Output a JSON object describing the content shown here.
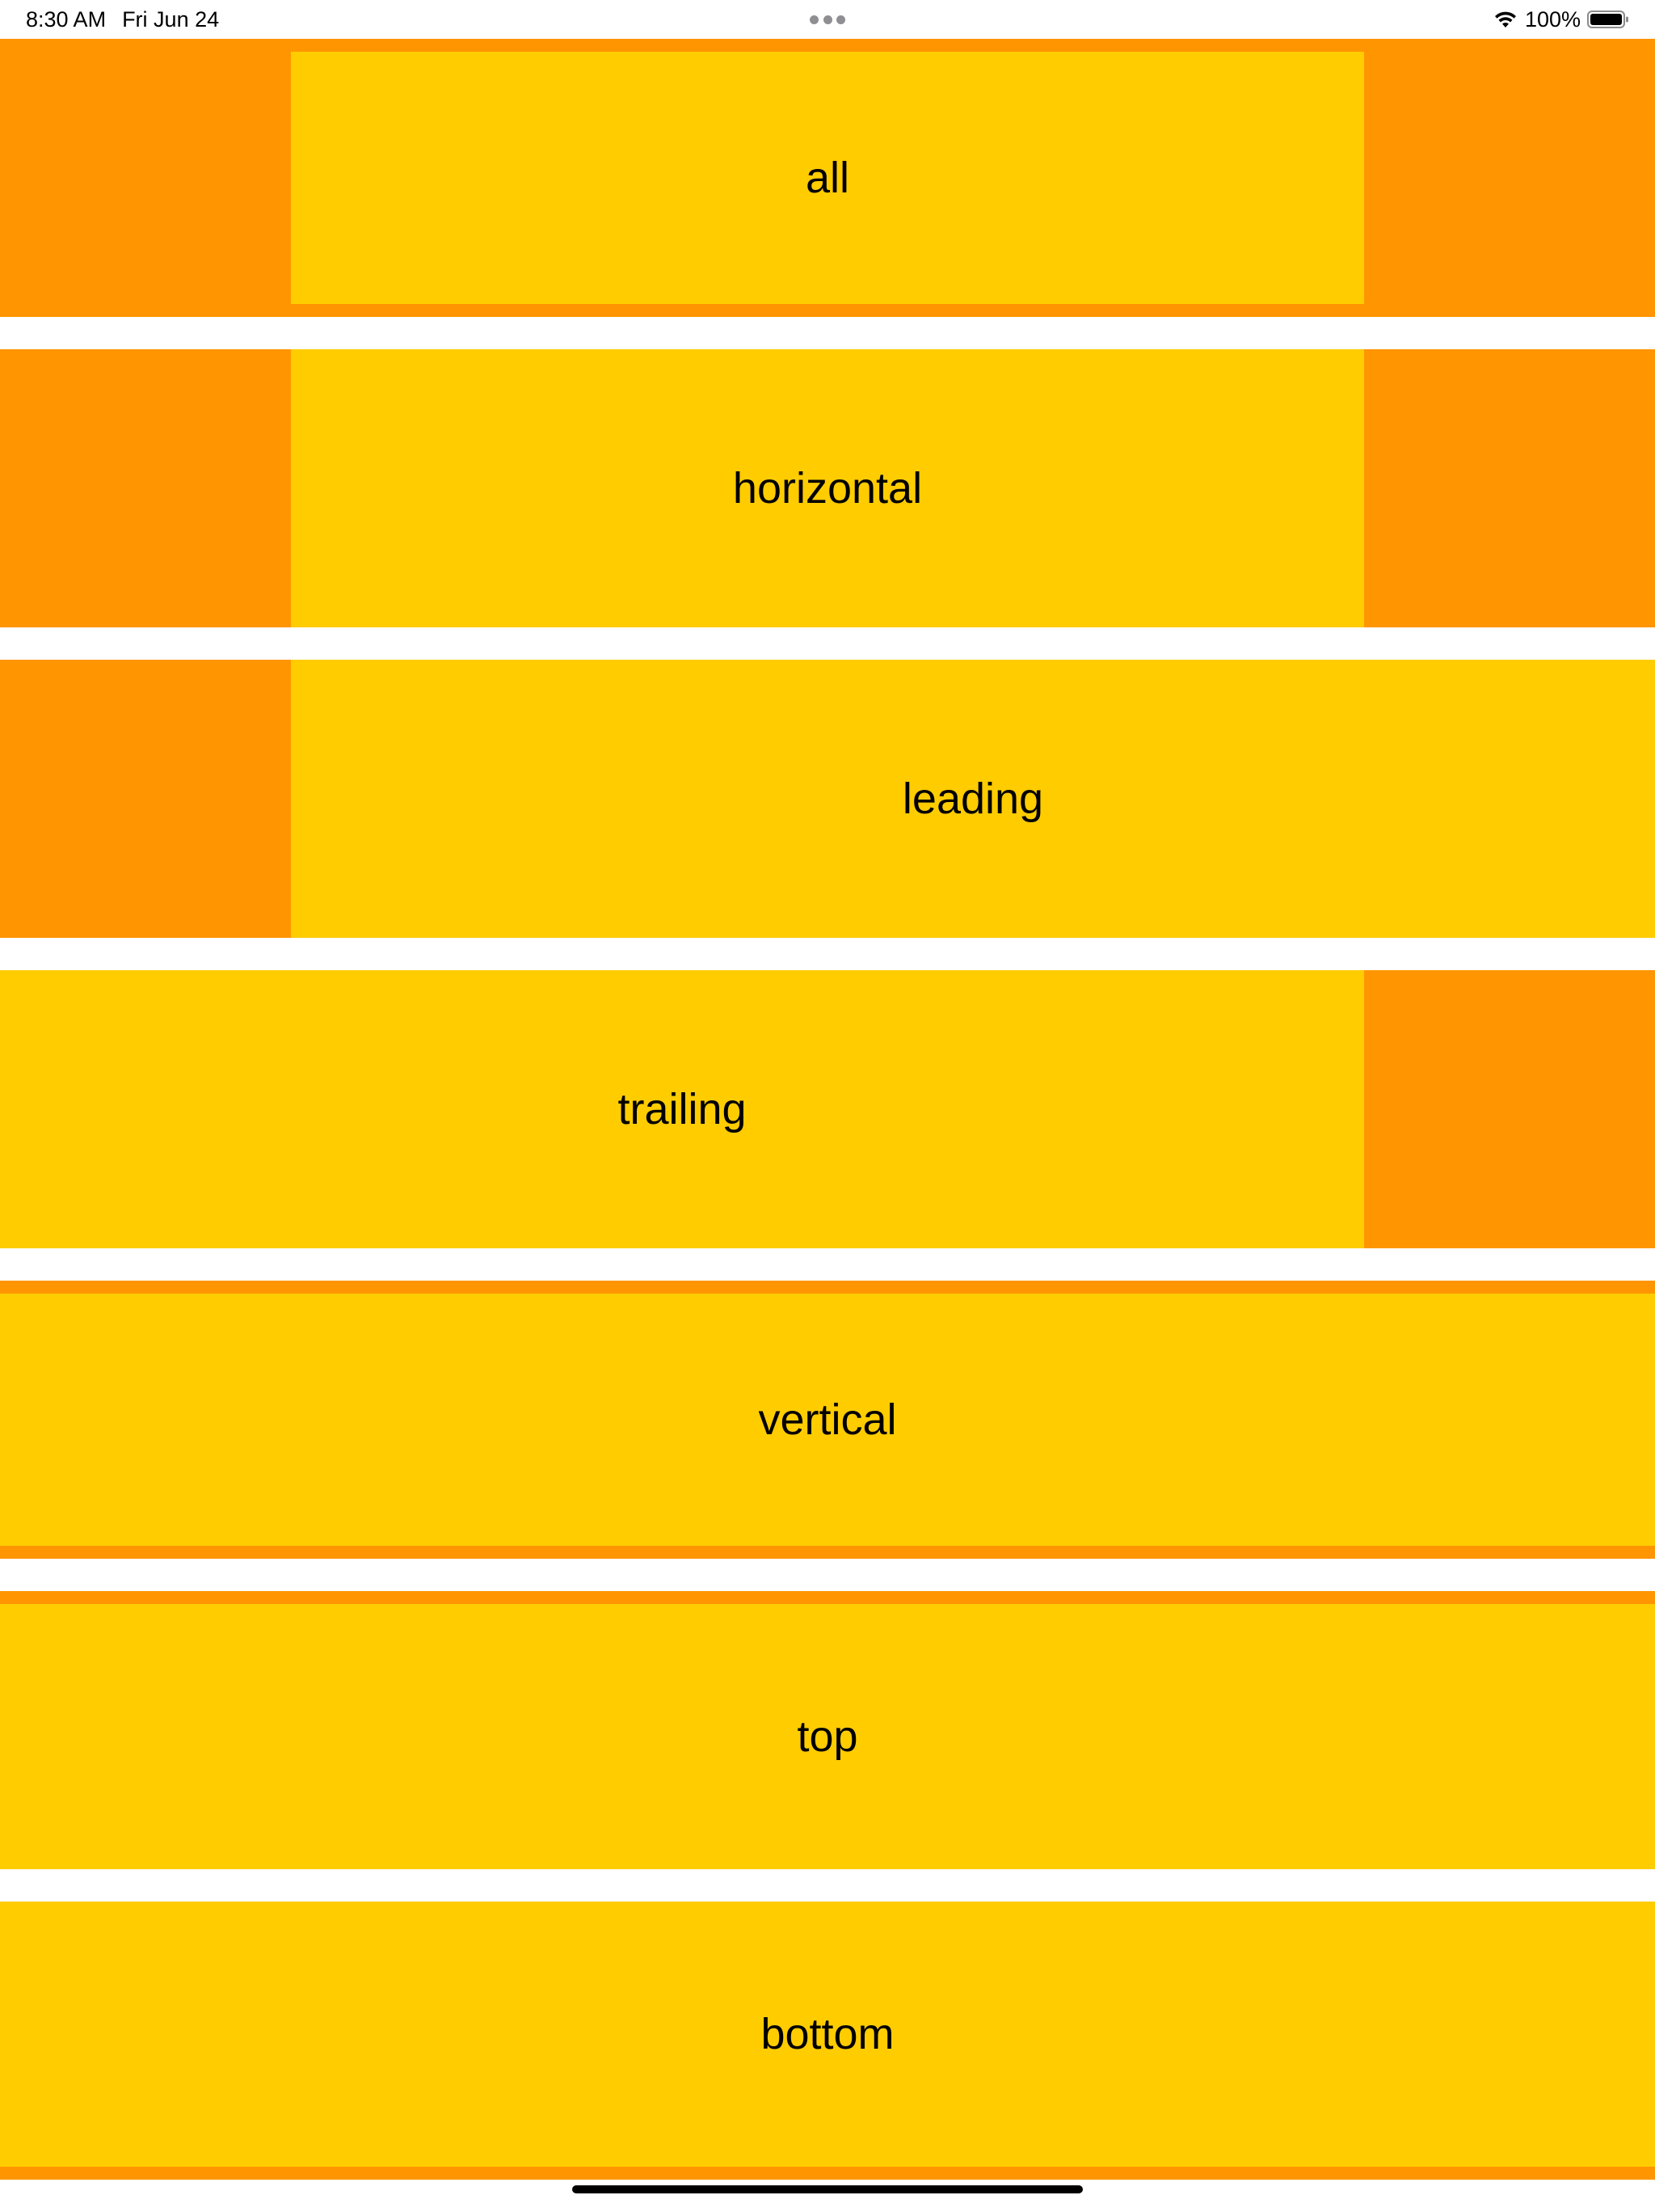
{
  "status_bar": {
    "time": "8:30 AM",
    "date": "Fri Jun 24",
    "battery_percent": "100%",
    "icons": [
      "multitasking-dots-icon",
      "wifi-icon",
      "battery-icon"
    ]
  },
  "colors": {
    "outer": "#FF9500",
    "inner": "#FFCC00",
    "text": "#000000",
    "background": "#FFFFFF"
  },
  "rows": [
    {
      "label": "all"
    },
    {
      "label": "horizontal"
    },
    {
      "label": "leading"
    },
    {
      "label": "trailing"
    },
    {
      "label": "vertical"
    },
    {
      "label": "top"
    },
    {
      "label": "bottom"
    }
  ]
}
